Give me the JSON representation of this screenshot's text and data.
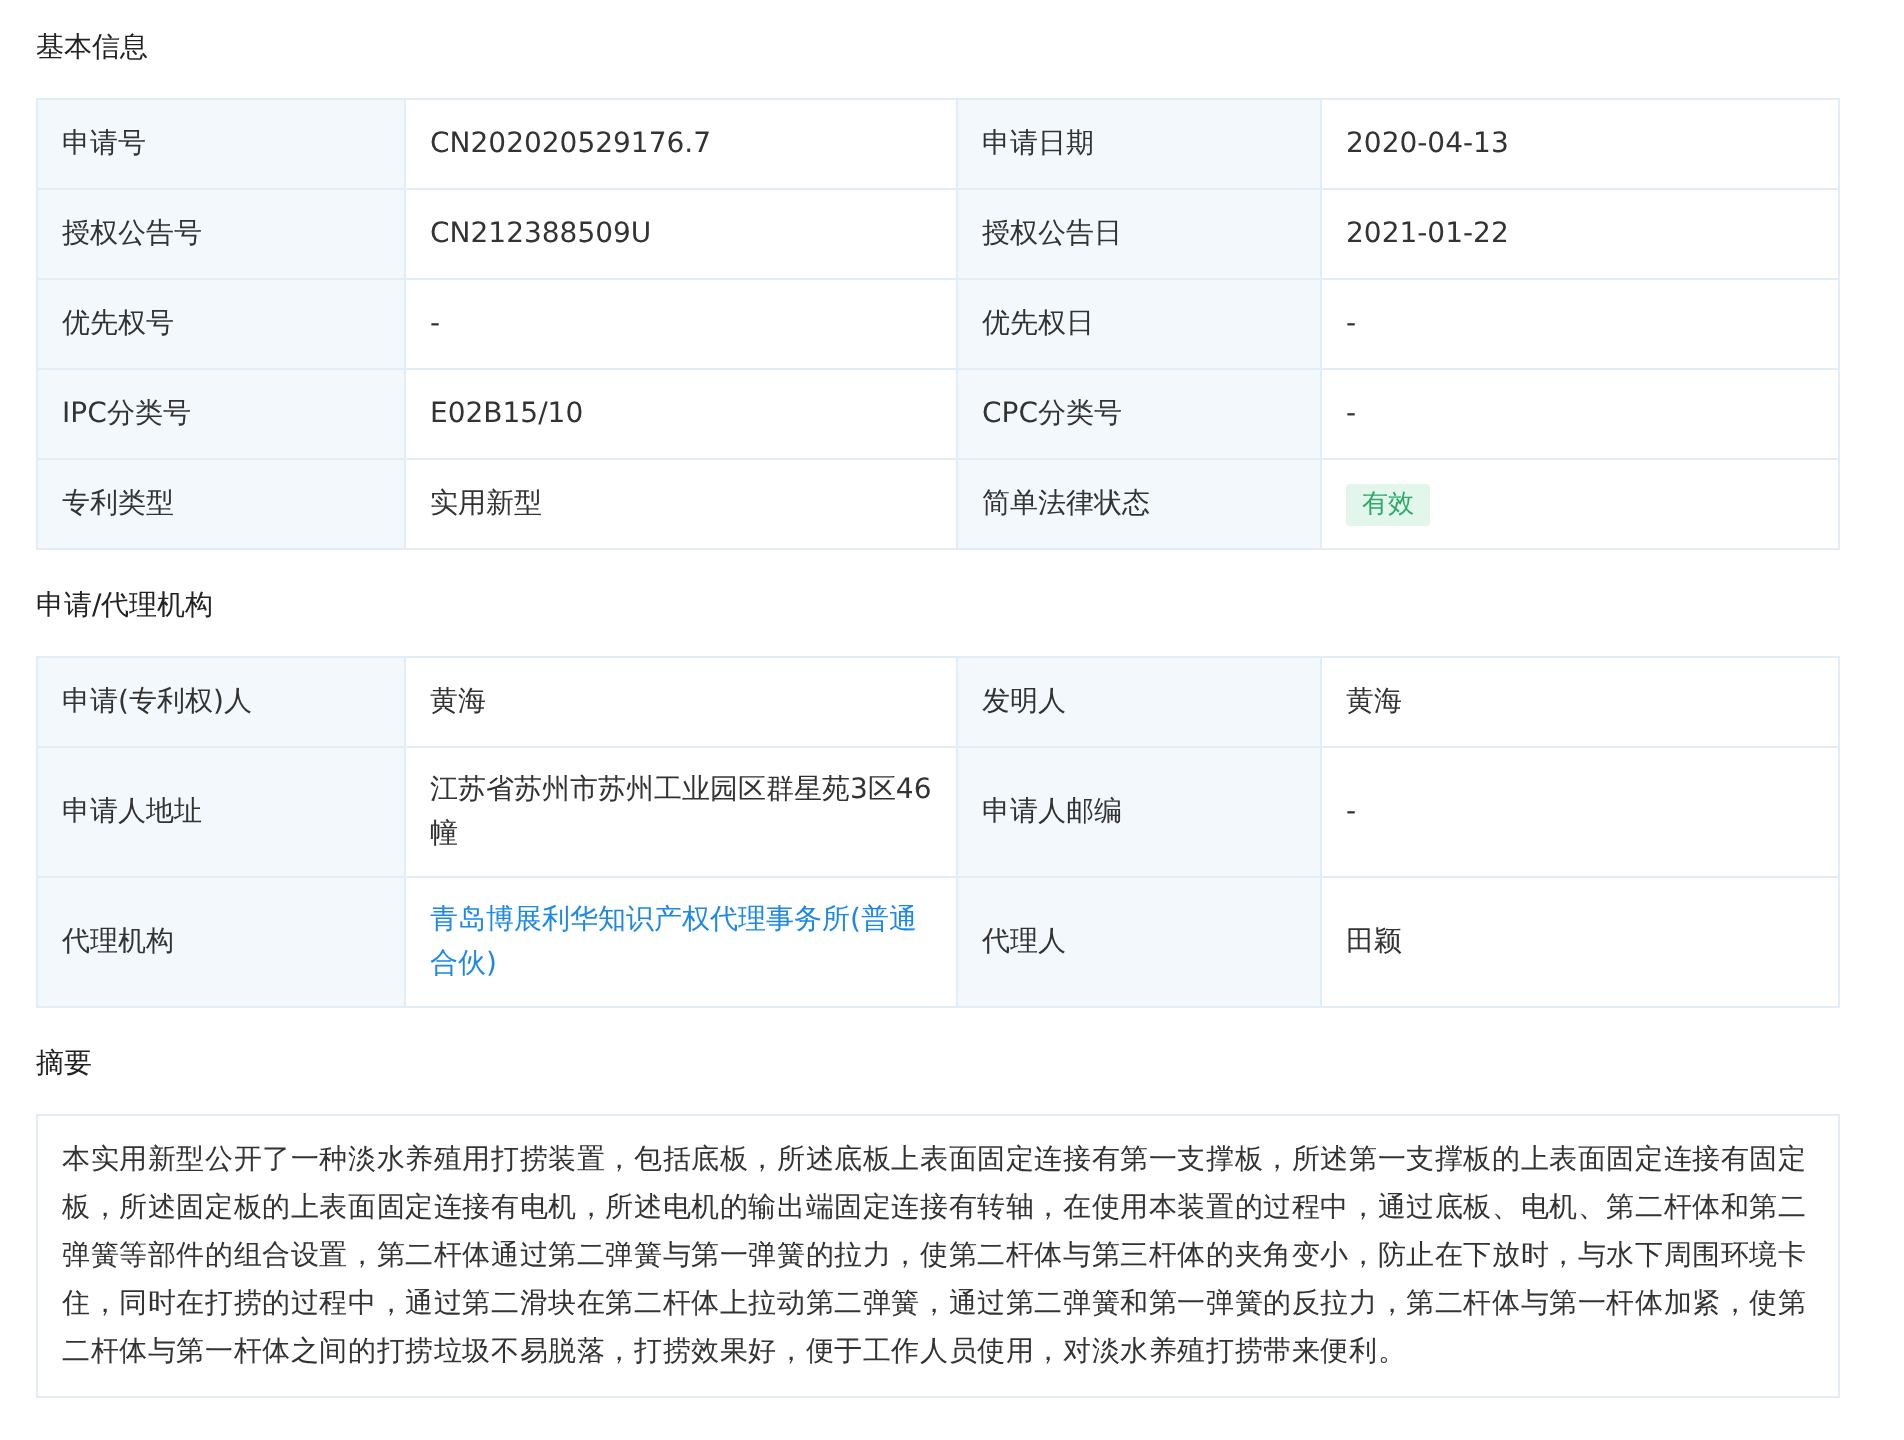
{
  "sections": [
    {
      "title": "基本信息",
      "kind": "table",
      "rows": [
        [
          {
            "kind": "label",
            "text": "申请号"
          },
          {
            "kind": "text",
            "text": "CN202020529176.7"
          },
          {
            "kind": "label",
            "text": "申请日期"
          },
          {
            "kind": "text",
            "text": "2020-04-13"
          }
        ],
        [
          {
            "kind": "label",
            "text": "授权公告号"
          },
          {
            "kind": "text",
            "text": "CN212388509U"
          },
          {
            "kind": "label",
            "text": "授权公告日"
          },
          {
            "kind": "text",
            "text": "2021-01-22"
          }
        ],
        [
          {
            "kind": "label",
            "text": "优先权号"
          },
          {
            "kind": "text",
            "text": "-"
          },
          {
            "kind": "label",
            "text": "优先权日"
          },
          {
            "kind": "text",
            "text": "-"
          }
        ],
        [
          {
            "kind": "label",
            "text": "IPC分类号"
          },
          {
            "kind": "text",
            "text": "E02B15/10"
          },
          {
            "kind": "label",
            "text": "CPC分类号"
          },
          {
            "kind": "text",
            "text": "-"
          }
        ],
        [
          {
            "kind": "label",
            "text": "专利类型"
          },
          {
            "kind": "text",
            "text": "实用新型"
          },
          {
            "kind": "label",
            "text": "简单法律状态"
          },
          {
            "kind": "badge",
            "text": "有效"
          }
        ]
      ]
    },
    {
      "title": "申请/代理机构",
      "kind": "table",
      "rows": [
        [
          {
            "kind": "label",
            "text": "申请(专利权)人"
          },
          {
            "kind": "text",
            "text": "黄海"
          },
          {
            "kind": "label",
            "text": "发明人"
          },
          {
            "kind": "text",
            "text": "黄海"
          }
        ],
        [
          {
            "kind": "label",
            "text": "申请人地址"
          },
          {
            "kind": "text",
            "text": "江苏省苏州市苏州工业园区群星苑3区46幢"
          },
          {
            "kind": "label",
            "text": "申请人邮编"
          },
          {
            "kind": "text",
            "text": "-"
          }
        ],
        [
          {
            "kind": "label",
            "text": "代理机构"
          },
          {
            "kind": "link",
            "text": "青岛博展利华知识产权代理事务所(普通合伙)"
          },
          {
            "kind": "label",
            "text": "代理人"
          },
          {
            "kind": "text",
            "text": "田颖"
          }
        ]
      ]
    },
    {
      "title": "摘要",
      "kind": "text",
      "text": "本实用新型公开了一种淡水养殖用打捞装置，包括底板，所述底板上表面固定连接有第一支撑板，所述第一支撑板的上表面固定连接有固定板，所述固定板的上表面固定连接有电机，所述电机的输出端固定连接有转轴，在使用本装置的过程中，通过底板、电机、第二杆体和第二弹簧等部件的组合设置，第二杆体通过第二弹簧与第一弹簧的拉力，使第二杆体与第三杆体的夹角变小，防止在下放时，与水下周围环境卡住，同时在打捞的过程中，通过第二滑块在第二杆体上拉动第二弹簧，通过第二弹簧和第一弹簧的反拉力，第二杆体与第一杆体加紧，使第二杆体与第一杆体之间的打捞垃圾不易脱落，打捞效果好，便于工作人员使用，对淡水养殖打捞带来便利。"
    }
  ]
}
